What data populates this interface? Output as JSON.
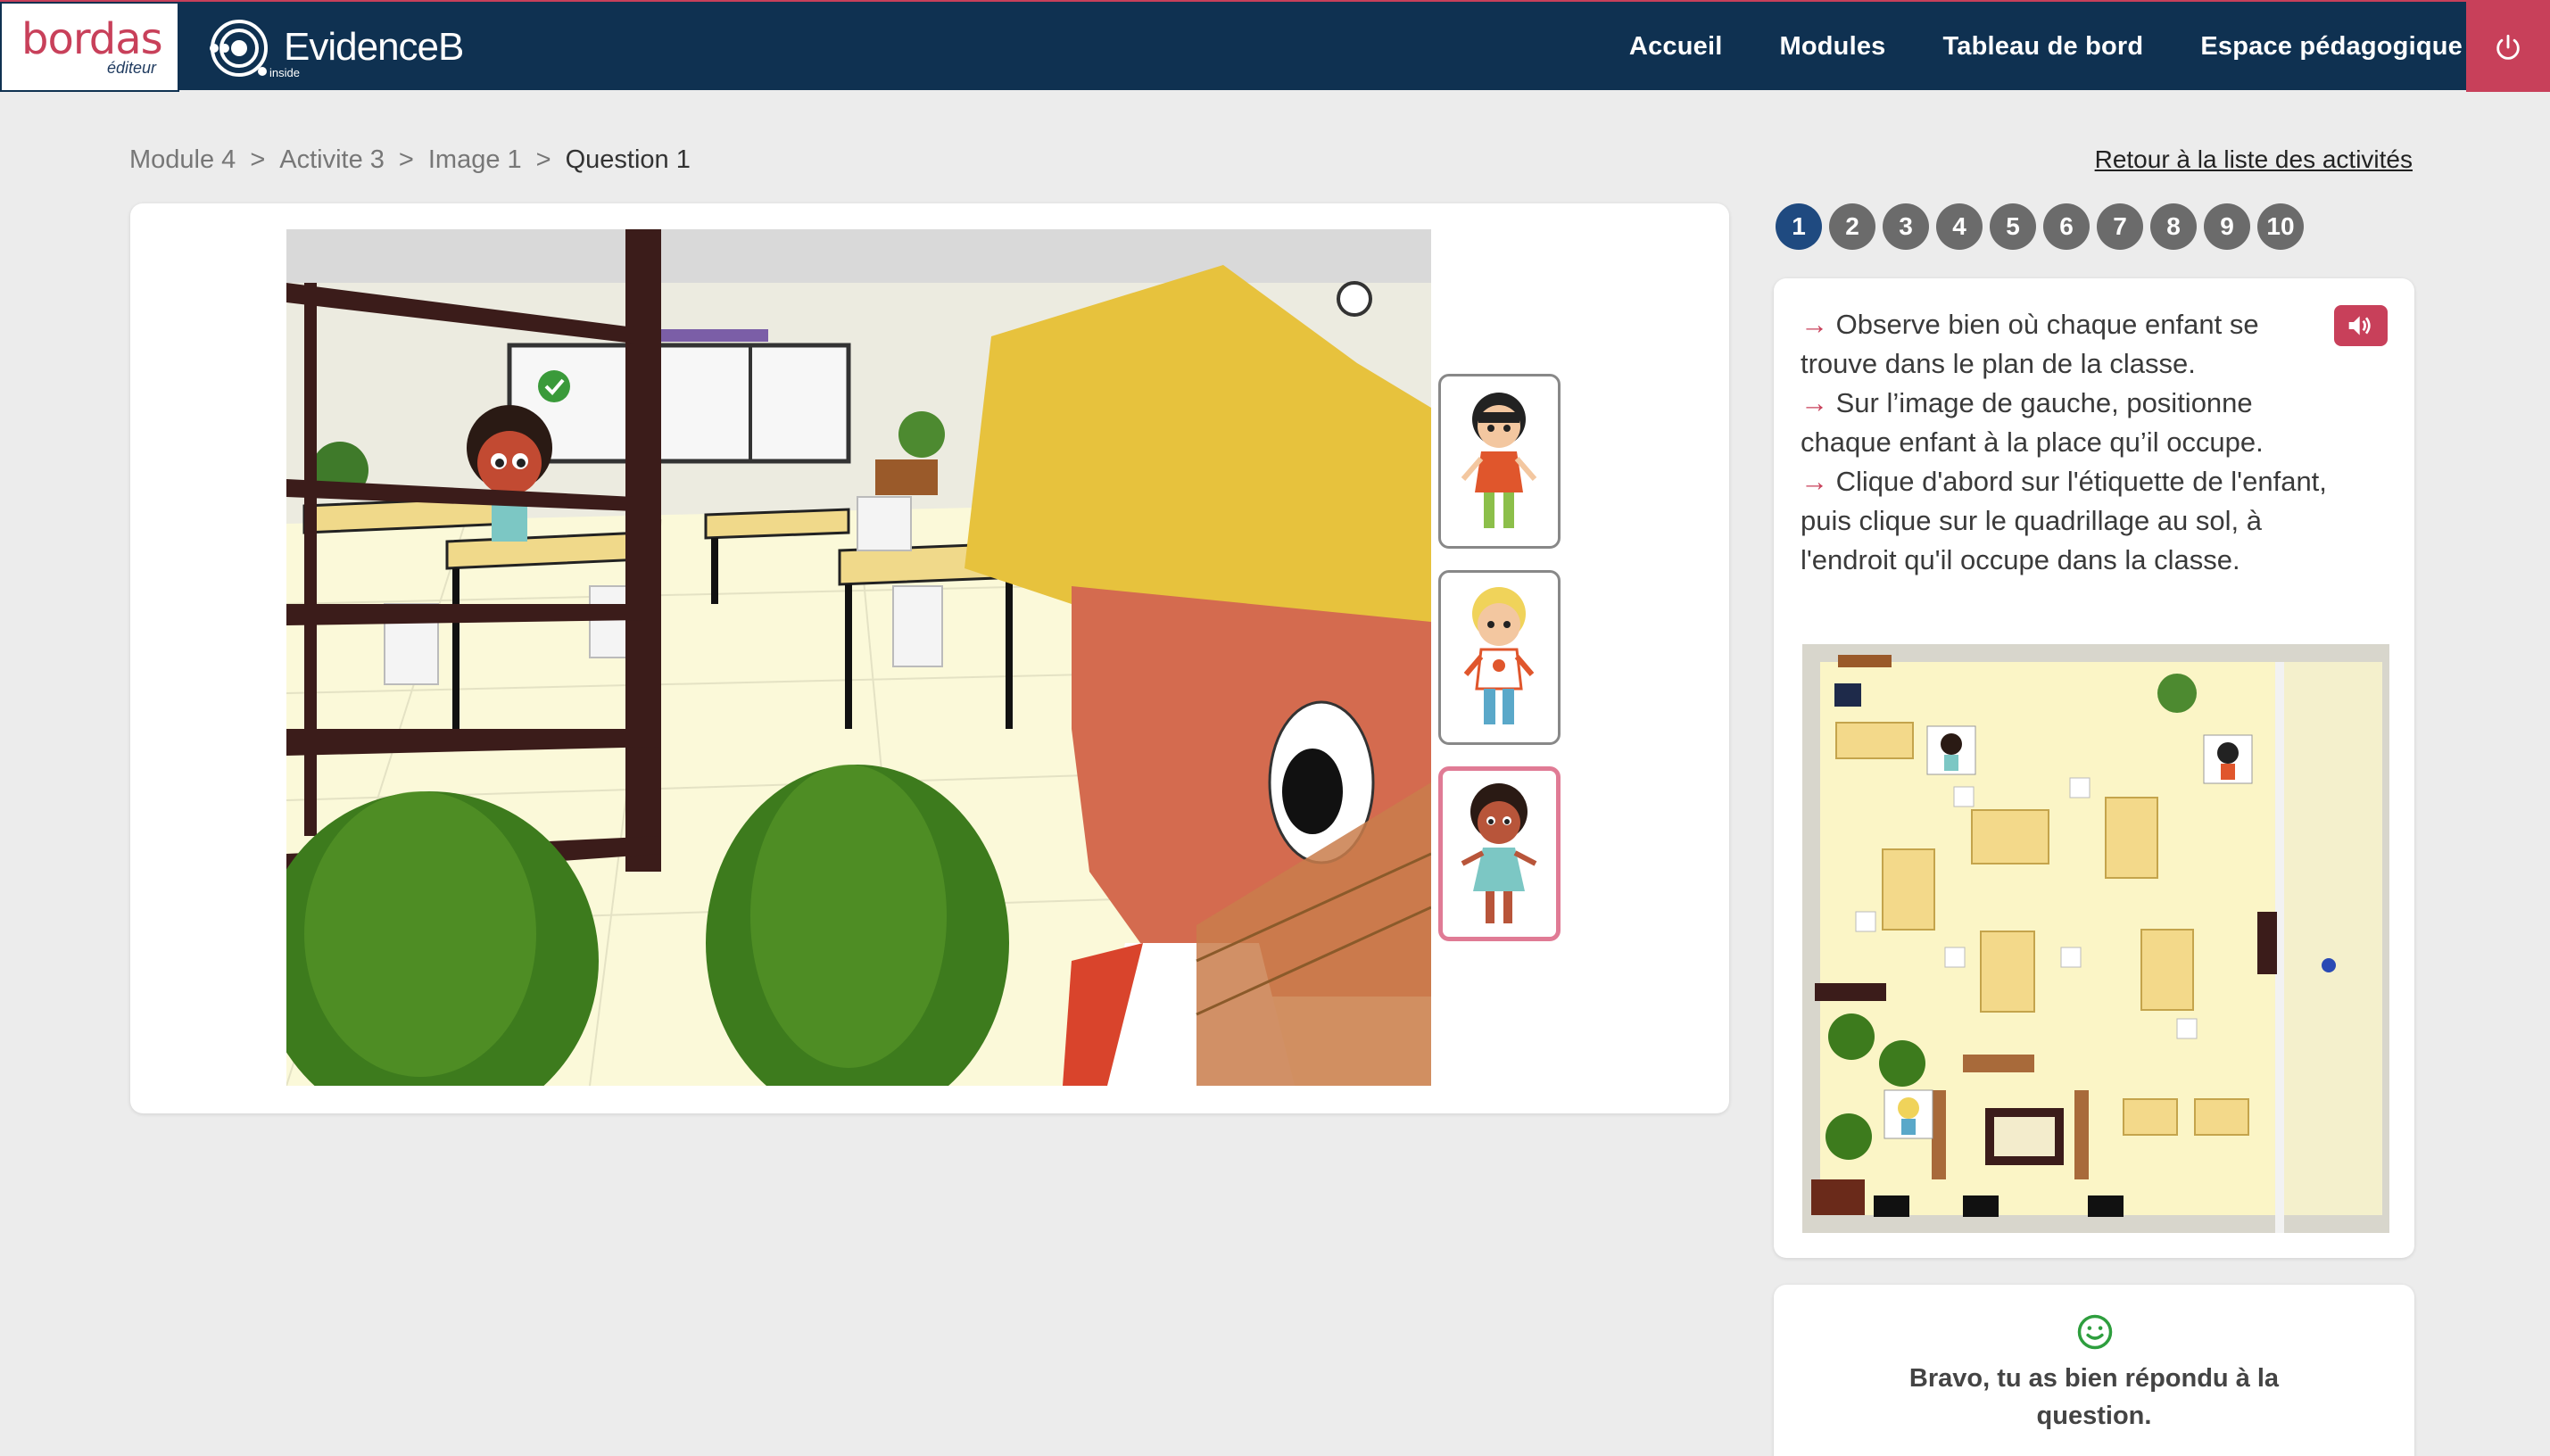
{
  "header": {
    "brand_bordas": "bordas",
    "brand_bordas_sub": "éditeur",
    "brand_evidenceb": "EvidenceB",
    "brand_evidenceb_sub": "inside",
    "nav": [
      "Accueil",
      "Modules",
      "Tableau de bord",
      "Espace pédagogique"
    ],
    "power_icon": "power-icon"
  },
  "breadcrumb": {
    "items": [
      "Module 4",
      ">",
      "Activite 3",
      ">",
      "Image 1",
      ">",
      "Question 1"
    ]
  },
  "back_link": "Retour à la liste des activités",
  "question_numbers": [
    "1",
    "2",
    "3",
    "4",
    "5",
    "6",
    "7",
    "8",
    "9",
    "10"
  ],
  "active_question": "1",
  "instructions": {
    "arrow": "→",
    "lines": [
      "Observe bien où chaque enfant se trouve dans le plan de la classe.",
      "Sur l’image de gauche, positionne chaque enfant à la place qu’il occupe.",
      "Clique d'abord sur l'étiquette de l'enfant, puis clique sur le quadrillage au sol, à l'endroit qu'il occupe dans la classe."
    ]
  },
  "feedback": {
    "icon": "smiley-icon",
    "text": "Bravo, tu as bien répondu à la question."
  },
  "colors": {
    "header_bg": "#0f3151",
    "accent": "#c8405a",
    "active_number": "#1f4a80",
    "success": "#2e9e3e"
  }
}
